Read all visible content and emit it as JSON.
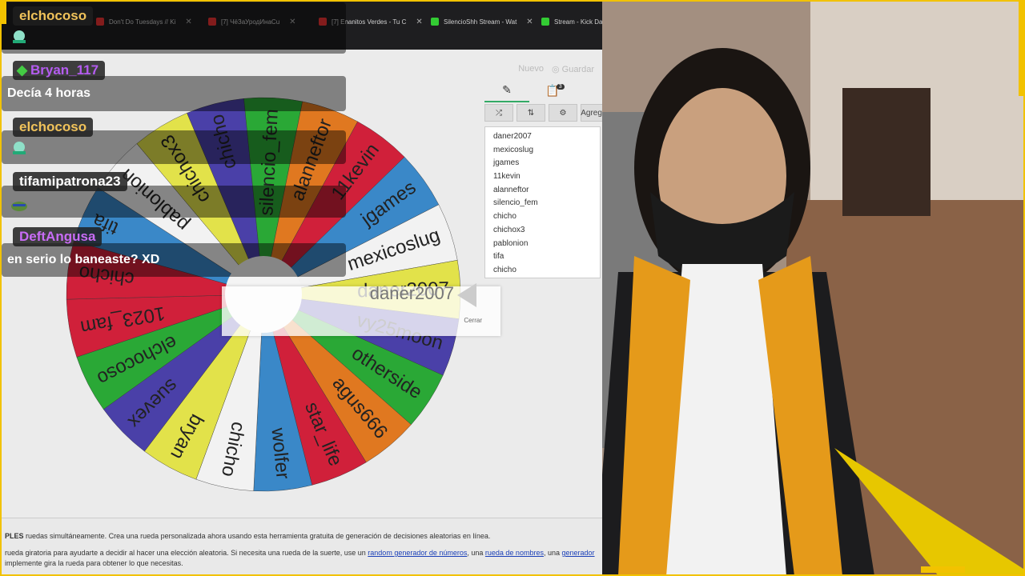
{
  "browser": {
    "tabs": [
      {
        "label": "Don't Do Tuesdays // Ki",
        "icon": "yt-icon",
        "color": "#e33"
      },
      {
        "label": "[7] ЧёЗаУродИнаСu",
        "icon": "yt-icon",
        "color": "#e33"
      },
      {
        "label": "[7] Enanitos Verdes - Tu C",
        "icon": "yt-icon",
        "color": "#e33"
      },
      {
        "label": "SilencioShh Stream - Wat",
        "icon": "kick-icon",
        "color": "#3c3"
      },
      {
        "label": "Stream - Kick Das",
        "icon": "kick-icon",
        "color": "#3c3"
      }
    ]
  },
  "page": {
    "top_buttons": {
      "nuevo": "Nuevo",
      "guardar": "Guardar"
    },
    "editor": {
      "tools": {
        "agregar": "Agregar"
      },
      "badge": "3",
      "entries": [
        "daner2007",
        "mexicoslug",
        "jgames",
        "11kevin",
        "alanneftor",
        "silencio_fem",
        "chicho",
        "chichox3",
        "pablonion",
        "tifa",
        "chicho"
      ]
    },
    "winner": {
      "name": "daner2007",
      "close_label": "Cerrar"
    },
    "wheel": {
      "segments": [
        {
          "label": "chicho",
          "color": "#4a40a8"
        },
        {
          "label": "silencio_fem",
          "color": "#2aa836"
        },
        {
          "label": "alanneftor",
          "color": "#e07820"
        },
        {
          "label": "11kevin",
          "color": "#d0203a"
        },
        {
          "label": "jgames",
          "color": "#3a88c8"
        },
        {
          "label": "mexicoslug",
          "color": "#f2f2f2"
        },
        {
          "label": "daner2007",
          "color": "#e2e24a"
        },
        {
          "label": "vy25moon",
          "color": "#4a40a8"
        },
        {
          "label": "otherside",
          "color": "#2aa836"
        },
        {
          "label": "agus666",
          "color": "#e07820"
        },
        {
          "label": "star_life",
          "color": "#d0203a"
        },
        {
          "label": "wolfer",
          "color": "#3a88c8"
        },
        {
          "label": "chicho",
          "color": "#f2f2f2"
        },
        {
          "label": "bryan",
          "color": "#e2e24a"
        },
        {
          "label": "suevex",
          "color": "#4a40a8"
        },
        {
          "label": "elchocoso",
          "color": "#2aa836"
        },
        {
          "label": "1023_fam",
          "color": "#d0203a"
        },
        {
          "label": "chicho",
          "color": "#d0203a"
        },
        {
          "label": "tifa",
          "color": "#3a88c8"
        },
        {
          "label": "pablonion",
          "color": "#f2f2f2"
        },
        {
          "label": "chichox3",
          "color": "#e2e24a"
        }
      ]
    },
    "footer": {
      "line1_bold": "PLES",
      "line1": " ruedas simultáneamente. Crea una rueda personalizada ahora usando esta herramienta gratuita de generación de decisiones aleatorias en línea.",
      "line2_a": "rueda giratoria para ayudarte a decidir al hacer una elección aleatoria. Si necesita una rueda de la suerte, use un ",
      "link1": "random generador de números",
      "line2_b": ", una ",
      "link2": "rueda de nombres",
      "line2_c": ", una ",
      "link3": "generador",
      "line3": "implemente gira la rueda para obtener lo que necesitas."
    }
  },
  "chat": {
    "messages": [
      {
        "user": "elchocoso",
        "user_color": "#f0c25a",
        "text": ""
      },
      {
        "user": "Bryan_117",
        "user_color": "#b45cf0",
        "text": "Decía 4 horas"
      },
      {
        "user": "elchocoso",
        "user_color": "#f0c25a",
        "text": ""
      },
      {
        "user": "tifamipatrona23",
        "user_color": "#ffffff",
        "text": ""
      },
      {
        "user": "DeftAngusa",
        "user_color": "#c86cf5",
        "text": "en serio lo baneaste? XD"
      }
    ]
  },
  "colors": {
    "frame_yellow": "#f2c200",
    "accent_green": "#3a6"
  }
}
